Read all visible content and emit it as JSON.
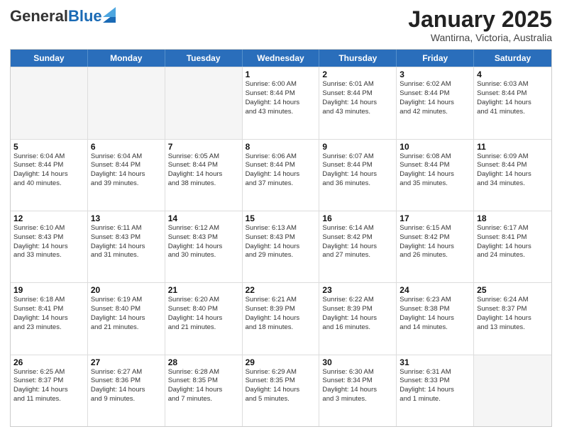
{
  "header": {
    "logo_general": "General",
    "logo_blue": "Blue",
    "month_title": "January 2025",
    "location": "Wantirna, Victoria, Australia"
  },
  "days_of_week": [
    "Sunday",
    "Monday",
    "Tuesday",
    "Wednesday",
    "Thursday",
    "Friday",
    "Saturday"
  ],
  "weeks": [
    [
      {
        "day": "",
        "lines": [],
        "empty": true
      },
      {
        "day": "",
        "lines": [],
        "empty": true
      },
      {
        "day": "",
        "lines": [],
        "empty": true
      },
      {
        "day": "1",
        "lines": [
          "Sunrise: 6:00 AM",
          "Sunset: 8:44 PM",
          "Daylight: 14 hours",
          "and 43 minutes."
        ],
        "empty": false
      },
      {
        "day": "2",
        "lines": [
          "Sunrise: 6:01 AM",
          "Sunset: 8:44 PM",
          "Daylight: 14 hours",
          "and 43 minutes."
        ],
        "empty": false
      },
      {
        "day": "3",
        "lines": [
          "Sunrise: 6:02 AM",
          "Sunset: 8:44 PM",
          "Daylight: 14 hours",
          "and 42 minutes."
        ],
        "empty": false
      },
      {
        "day": "4",
        "lines": [
          "Sunrise: 6:03 AM",
          "Sunset: 8:44 PM",
          "Daylight: 14 hours",
          "and 41 minutes."
        ],
        "empty": false
      }
    ],
    [
      {
        "day": "5",
        "lines": [
          "Sunrise: 6:04 AM",
          "Sunset: 8:44 PM",
          "Daylight: 14 hours",
          "and 40 minutes."
        ],
        "empty": false
      },
      {
        "day": "6",
        "lines": [
          "Sunrise: 6:04 AM",
          "Sunset: 8:44 PM",
          "Daylight: 14 hours",
          "and 39 minutes."
        ],
        "empty": false
      },
      {
        "day": "7",
        "lines": [
          "Sunrise: 6:05 AM",
          "Sunset: 8:44 PM",
          "Daylight: 14 hours",
          "and 38 minutes."
        ],
        "empty": false
      },
      {
        "day": "8",
        "lines": [
          "Sunrise: 6:06 AM",
          "Sunset: 8:44 PM",
          "Daylight: 14 hours",
          "and 37 minutes."
        ],
        "empty": false
      },
      {
        "day": "9",
        "lines": [
          "Sunrise: 6:07 AM",
          "Sunset: 8:44 PM",
          "Daylight: 14 hours",
          "and 36 minutes."
        ],
        "empty": false
      },
      {
        "day": "10",
        "lines": [
          "Sunrise: 6:08 AM",
          "Sunset: 8:44 PM",
          "Daylight: 14 hours",
          "and 35 minutes."
        ],
        "empty": false
      },
      {
        "day": "11",
        "lines": [
          "Sunrise: 6:09 AM",
          "Sunset: 8:44 PM",
          "Daylight: 14 hours",
          "and 34 minutes."
        ],
        "empty": false
      }
    ],
    [
      {
        "day": "12",
        "lines": [
          "Sunrise: 6:10 AM",
          "Sunset: 8:43 PM",
          "Daylight: 14 hours",
          "and 33 minutes."
        ],
        "empty": false
      },
      {
        "day": "13",
        "lines": [
          "Sunrise: 6:11 AM",
          "Sunset: 8:43 PM",
          "Daylight: 14 hours",
          "and 31 minutes."
        ],
        "empty": false
      },
      {
        "day": "14",
        "lines": [
          "Sunrise: 6:12 AM",
          "Sunset: 8:43 PM",
          "Daylight: 14 hours",
          "and 30 minutes."
        ],
        "empty": false
      },
      {
        "day": "15",
        "lines": [
          "Sunrise: 6:13 AM",
          "Sunset: 8:43 PM",
          "Daylight: 14 hours",
          "and 29 minutes."
        ],
        "empty": false
      },
      {
        "day": "16",
        "lines": [
          "Sunrise: 6:14 AM",
          "Sunset: 8:42 PM",
          "Daylight: 14 hours",
          "and 27 minutes."
        ],
        "empty": false
      },
      {
        "day": "17",
        "lines": [
          "Sunrise: 6:15 AM",
          "Sunset: 8:42 PM",
          "Daylight: 14 hours",
          "and 26 minutes."
        ],
        "empty": false
      },
      {
        "day": "18",
        "lines": [
          "Sunrise: 6:17 AM",
          "Sunset: 8:41 PM",
          "Daylight: 14 hours",
          "and 24 minutes."
        ],
        "empty": false
      }
    ],
    [
      {
        "day": "19",
        "lines": [
          "Sunrise: 6:18 AM",
          "Sunset: 8:41 PM",
          "Daylight: 14 hours",
          "and 23 minutes."
        ],
        "empty": false
      },
      {
        "day": "20",
        "lines": [
          "Sunrise: 6:19 AM",
          "Sunset: 8:40 PM",
          "Daylight: 14 hours",
          "and 21 minutes."
        ],
        "empty": false
      },
      {
        "day": "21",
        "lines": [
          "Sunrise: 6:20 AM",
          "Sunset: 8:40 PM",
          "Daylight: 14 hours",
          "and 21 minutes."
        ],
        "empty": false
      },
      {
        "day": "22",
        "lines": [
          "Sunrise: 6:21 AM",
          "Sunset: 8:39 PM",
          "Daylight: 14 hours",
          "and 18 minutes."
        ],
        "empty": false
      },
      {
        "day": "23",
        "lines": [
          "Sunrise: 6:22 AM",
          "Sunset: 8:39 PM",
          "Daylight: 14 hours",
          "and 16 minutes."
        ],
        "empty": false
      },
      {
        "day": "24",
        "lines": [
          "Sunrise: 6:23 AM",
          "Sunset: 8:38 PM",
          "Daylight: 14 hours",
          "and 14 minutes."
        ],
        "empty": false
      },
      {
        "day": "25",
        "lines": [
          "Sunrise: 6:24 AM",
          "Sunset: 8:37 PM",
          "Daylight: 14 hours",
          "and 13 minutes."
        ],
        "empty": false
      }
    ],
    [
      {
        "day": "26",
        "lines": [
          "Sunrise: 6:25 AM",
          "Sunset: 8:37 PM",
          "Daylight: 14 hours",
          "and 11 minutes."
        ],
        "empty": false
      },
      {
        "day": "27",
        "lines": [
          "Sunrise: 6:27 AM",
          "Sunset: 8:36 PM",
          "Daylight: 14 hours",
          "and 9 minutes."
        ],
        "empty": false
      },
      {
        "day": "28",
        "lines": [
          "Sunrise: 6:28 AM",
          "Sunset: 8:35 PM",
          "Daylight: 14 hours",
          "and 7 minutes."
        ],
        "empty": false
      },
      {
        "day": "29",
        "lines": [
          "Sunrise: 6:29 AM",
          "Sunset: 8:35 PM",
          "Daylight: 14 hours",
          "and 5 minutes."
        ],
        "empty": false
      },
      {
        "day": "30",
        "lines": [
          "Sunrise: 6:30 AM",
          "Sunset: 8:34 PM",
          "Daylight: 14 hours",
          "and 3 minutes."
        ],
        "empty": false
      },
      {
        "day": "31",
        "lines": [
          "Sunrise: 6:31 AM",
          "Sunset: 8:33 PM",
          "Daylight: 14 hours",
          "and 1 minute."
        ],
        "empty": false
      },
      {
        "day": "",
        "lines": [],
        "empty": true
      }
    ]
  ]
}
